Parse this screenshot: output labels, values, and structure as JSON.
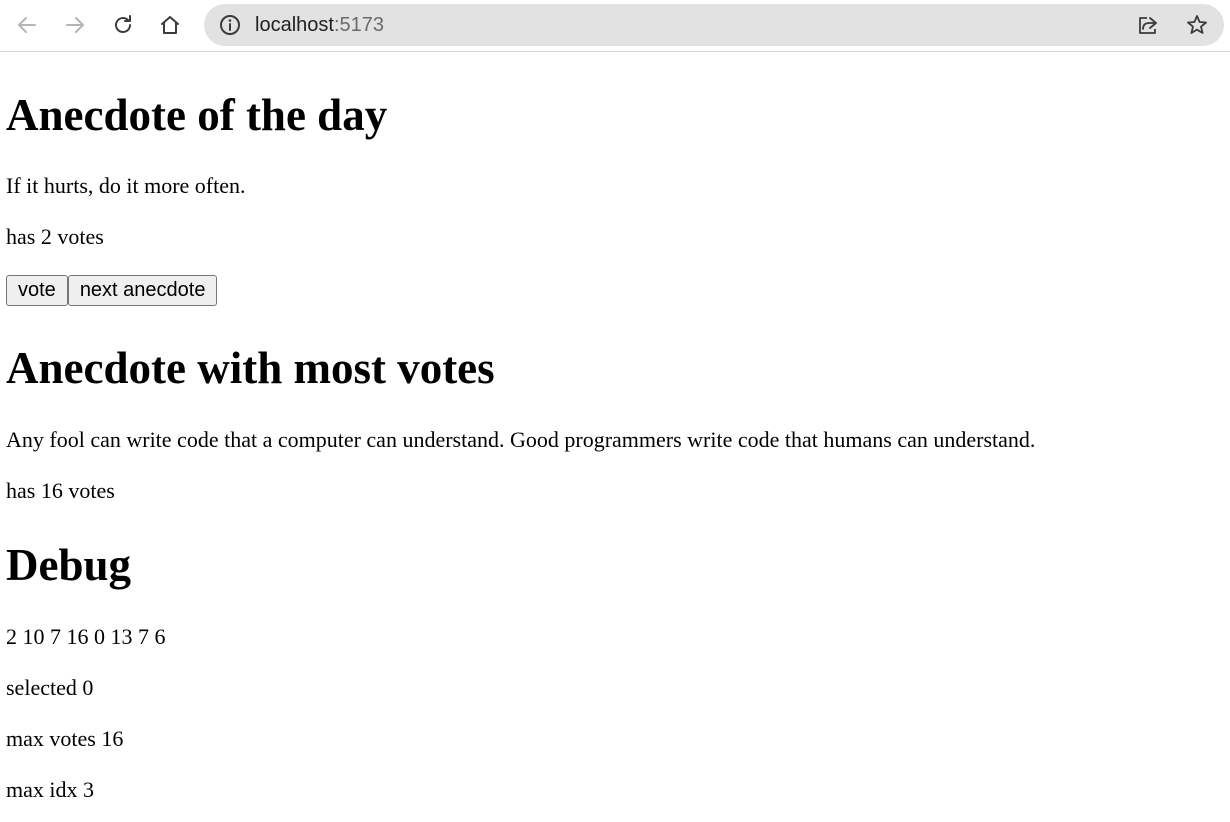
{
  "browser": {
    "url_host": "localhost",
    "url_port": ":5173",
    "icons": {
      "back": "arrow-left-icon",
      "forward": "arrow-right-icon",
      "reload": "reload-icon",
      "home": "home-icon",
      "site_info": "info-icon",
      "share": "share-icon",
      "bookmark": "star-icon"
    }
  },
  "day_section": {
    "heading": "Anecdote of the day",
    "anecdote": "If it hurts, do it more often.",
    "votes_text": "has 2 votes",
    "vote_button": "vote",
    "next_button": "next anecdote"
  },
  "most_votes_section": {
    "heading": "Anecdote with most votes",
    "anecdote": "Any fool can write code that a computer can understand. Good programmers write code that humans can understand.",
    "votes_text": "has 16 votes"
  },
  "debug_section": {
    "heading": "Debug",
    "votes_list": "2 10 7 16 0 13 7 6",
    "selected_text": "selected 0",
    "max_votes_text": "max votes 16",
    "max_idx_text": "max idx 3"
  }
}
